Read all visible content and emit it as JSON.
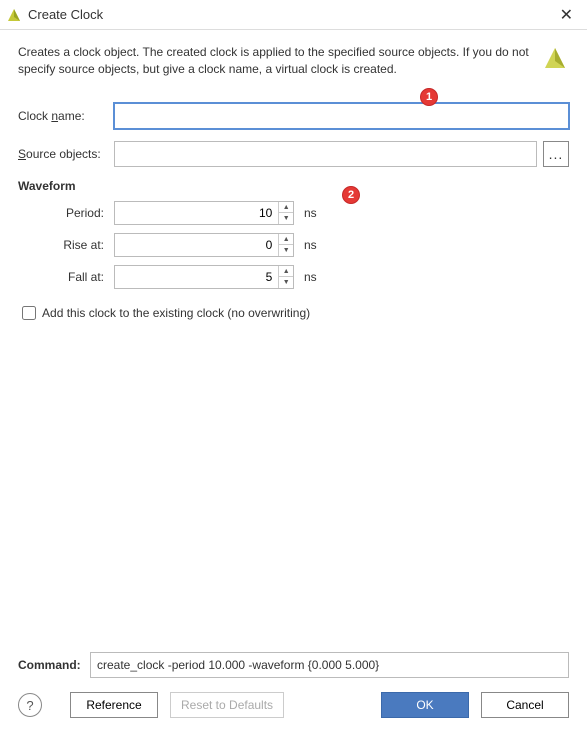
{
  "window": {
    "title": "Create Clock"
  },
  "description": "Creates a clock object. The created clock is applied to the specified source objects. If you do not specify source objects, but give a clock name, a virtual clock is created.",
  "callouts": {
    "c1": "1",
    "c2": "2"
  },
  "fields": {
    "clock_name": {
      "label_pre": "Clock ",
      "label_u": "n",
      "label_post": "ame:",
      "value": ""
    },
    "source_objects": {
      "label_pre": "",
      "label_u": "S",
      "label_post": "ource objects:",
      "value": ""
    },
    "browse": "..."
  },
  "waveform": {
    "title": "Waveform",
    "period": {
      "label_u": "P",
      "label_post": "eriod:",
      "value": "10",
      "unit": "ns"
    },
    "rise": {
      "label_u": "R",
      "label_post": "ise at:",
      "value": "0",
      "unit": "ns"
    },
    "fall": {
      "label_u": "F",
      "label_post": "all at:",
      "value": "5",
      "unit": "ns"
    }
  },
  "checkbox": {
    "checked": false,
    "label_u": "A",
    "label_post": "dd this clock to the existing clock (no overwriting)"
  },
  "command": {
    "label": "Command:",
    "value": "create_clock -period 10.000 -waveform {0.000 5.000}"
  },
  "buttons": {
    "help": "?",
    "reference": "Reference",
    "reset": "Reset to Defaults",
    "ok": "OK",
    "cancel": "Cancel"
  }
}
